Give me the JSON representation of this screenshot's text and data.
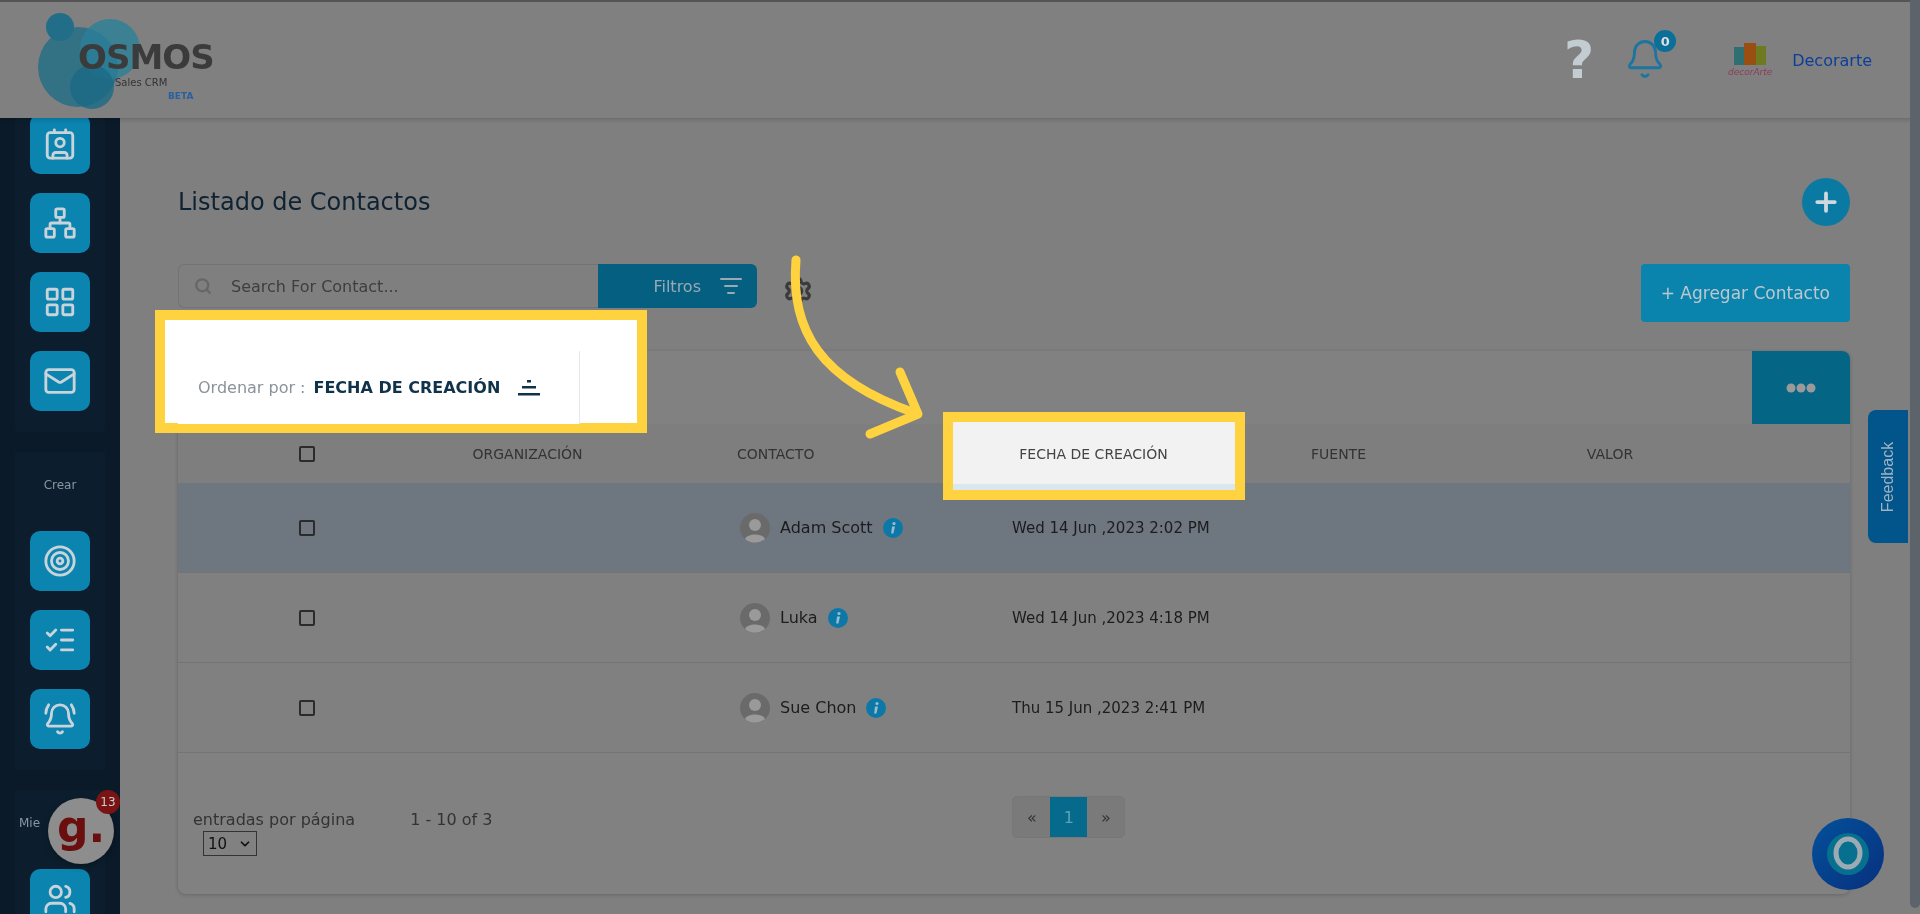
{
  "header": {
    "brand": "OSMOS",
    "brand_subtitle": "Sales CRM",
    "brand_tag": "BETA",
    "help": "?",
    "notifications": "0",
    "company_logo_text": "decorArte",
    "company": "Decorarte"
  },
  "sidebar": {
    "groups": [
      {
        "items": [
          {
            "kind": "contact"
          },
          {
            "kind": "hierarchy"
          },
          {
            "kind": "grid"
          },
          {
            "kind": "mail"
          }
        ]
      },
      {
        "label": "Crear",
        "items": [
          {
            "kind": "target"
          },
          {
            "kind": "checklist"
          },
          {
            "kind": "bell"
          }
        ]
      },
      {
        "label": "Mie",
        "items": [
          {
            "kind": "users"
          }
        ]
      }
    ]
  },
  "page": {
    "title": "Listado de Contactos"
  },
  "toolbar": {
    "search_placeholder": "Search For Contact...",
    "filters": "Filtros",
    "add_contact": "+ Agregar Contacto"
  },
  "sort": {
    "label": "Ordenar por :",
    "value": "FECHA DE CREACIÓN",
    "highlighted": true
  },
  "table": {
    "columns": [
      {
        "kind": "checkbox",
        "checked": false,
        "highlighted": false
      },
      {
        "kind": "text",
        "label": "ORGANIZACIÓN",
        "highlighted": false
      },
      {
        "kind": "text",
        "label": "CONTACTO",
        "highlighted": false
      },
      {
        "kind": "text",
        "label": "FECHA DE CREACIÓN",
        "highlighted": true
      },
      {
        "kind": "text",
        "label": "FUENTE",
        "highlighted": false
      },
      {
        "kind": "text",
        "label": "VALOR",
        "highlighted": false
      }
    ],
    "rows": [
      {
        "selected": true,
        "checked": false,
        "contact": "Adam Scott",
        "created": "Wed 14 Jun ,2023 2:02 PM"
      },
      {
        "selected": false,
        "checked": false,
        "contact": "Luka",
        "created": "Wed 14 Jun ,2023 4:18 PM"
      },
      {
        "selected": false,
        "checked": false,
        "contact": "Sue Chon",
        "created": "Thu 15 Jun ,2023 2:41 PM"
      }
    ]
  },
  "footer": {
    "per_page_label": "entradas por página",
    "per_page": "10",
    "range": "1 - 10 of 3"
  },
  "pagination": {
    "prev": "«",
    "pages": [
      {
        "label": "1",
        "selected": true
      }
    ],
    "next": "»"
  },
  "feedback": "Feedback",
  "extension_badge": {
    "logo": "g.",
    "count": "13"
  }
}
